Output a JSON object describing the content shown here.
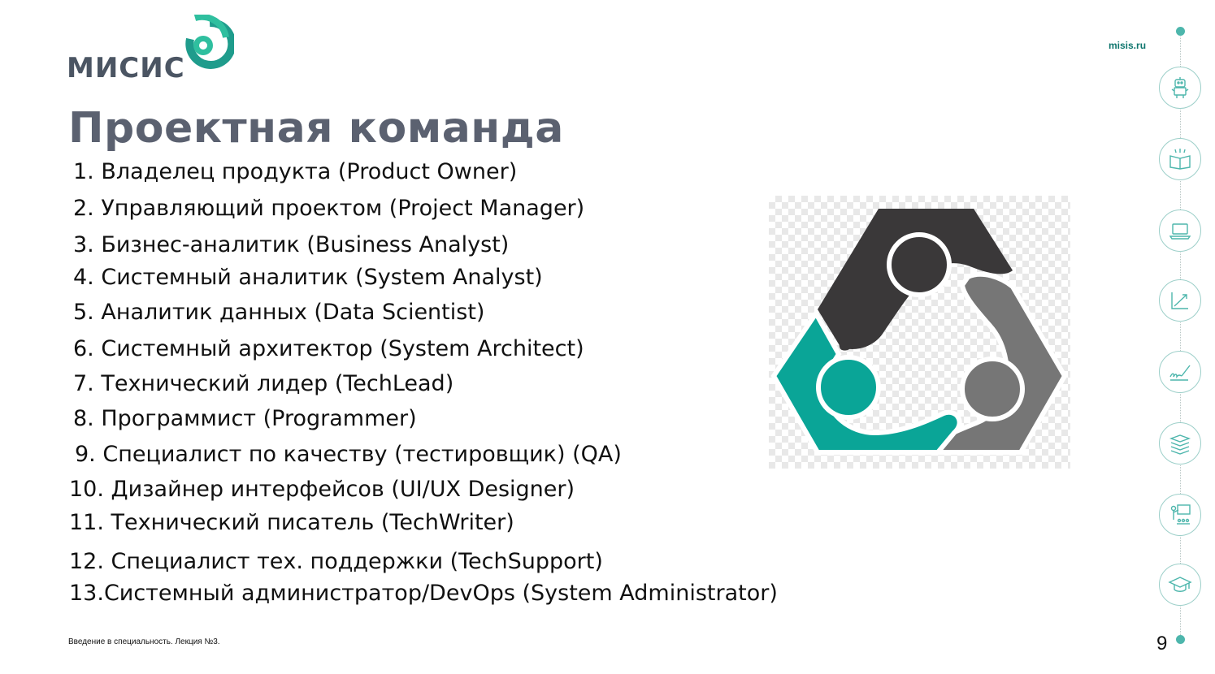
{
  "header": {
    "logo_text": "МИСИС",
    "site": "misis.ru"
  },
  "slide": {
    "title": "Проектная команда",
    "roles": [
      "1. Владелец продукта (Product Owner)",
      "2. Управляющий проектом (Project Manager)",
      "3. Бизнес-аналитик (Business Analyst)",
      "4. Системный аналитик (System Analyst)",
      "5. Аналитик данных (Data Scientist)",
      "6. Системный архитектор (System Architect)",
      "7. Технический лидер (TechLead)",
      "8. Программист (Programmer)",
      "9. Специалист по качеству (тестировщик) (QA)",
      "10. Дизайнер интерфейсов (UI/UX Designer)",
      "11. Технический писатель (TechWriter)",
      "12. Специалист тех. поддержки (TechSupport)",
      "13.Системный администратор/DevOps (System Administrator)"
    ],
    "picture_icon": "team-people-icon"
  },
  "footer": {
    "caption": "Введение в специальность. Лекция №3.",
    "page_number": "9"
  },
  "rail_icons": [
    "robot-icon",
    "book-icon",
    "laptop-icon",
    "chart-icon",
    "signature-icon",
    "books-stack-icon",
    "teacher-icon",
    "graduation-cap-icon"
  ],
  "colors": {
    "accent": "#4db6ac",
    "title": "#5b6170",
    "teal": "#0aa597",
    "dark_person": "#3a3839",
    "gray_person": "#767676"
  }
}
